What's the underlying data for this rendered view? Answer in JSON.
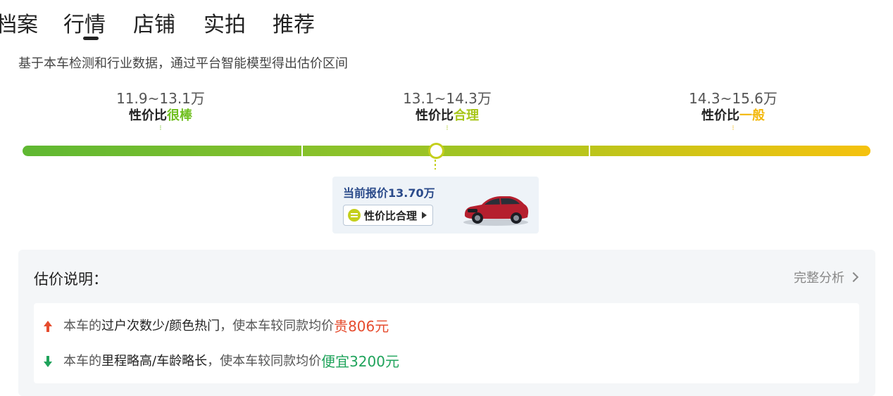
{
  "tabs": [
    "档案",
    "行情",
    "店铺",
    "实拍",
    "推荐"
  ],
  "active_tab": "行情",
  "subtitle": "基于本车检测和行业数据，通过平台智能模型得出估价区间",
  "ranges": [
    {
      "price": "11.9~13.1万",
      "prefix": "性价比",
      "rating": "很棒",
      "color": "#6fbf1f"
    },
    {
      "price": "13.1~14.3万",
      "prefix": "性价比",
      "rating": "合理",
      "color": "#a8c61a"
    },
    {
      "price": "14.3~15.6万",
      "prefix": "性价比",
      "rating": "一般",
      "color": "#f3b80c"
    }
  ],
  "quote": {
    "title": "当前报价13.70万",
    "verdict": "性价比合理"
  },
  "explain": {
    "title": "估价说明：",
    "full_analysis": "完整分析",
    "reasons": [
      {
        "p1": "本车的",
        "em": "过户次数少/颜色热门",
        "p2": "，使本车较同款均价",
        "impact": "贵806元",
        "direction": "up"
      },
      {
        "p1": "本车的",
        "em": "里程略高/车龄略长",
        "p2": "，使本车较同款均价",
        "impact": "便宜3200元",
        "direction": "down"
      }
    ]
  },
  "colors": {
    "up": "#e64c2e",
    "down": "#1fa35b",
    "marker": "#c4cf1c"
  }
}
